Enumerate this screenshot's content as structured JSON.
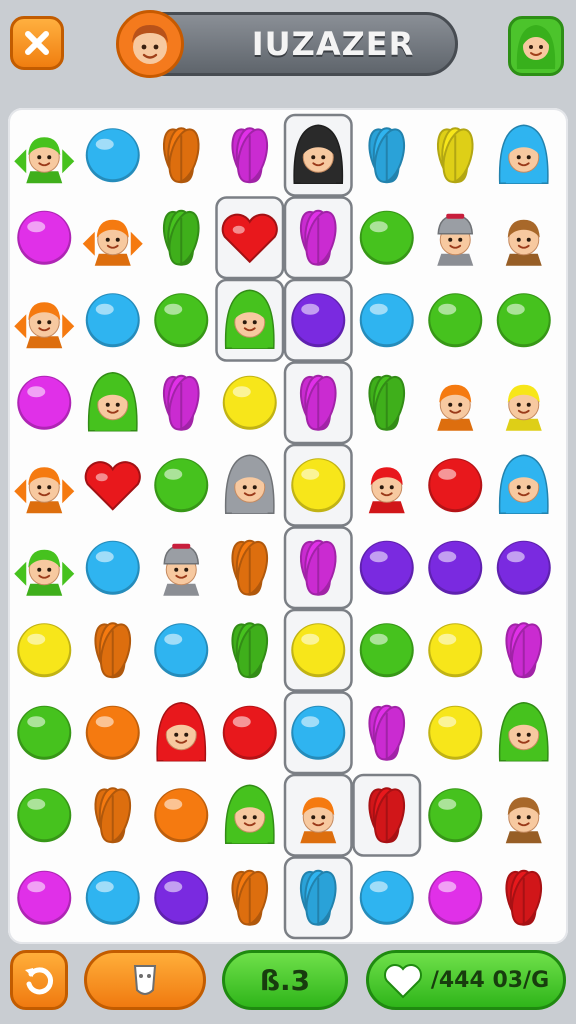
{
  "header": {
    "close_icon": "close-x-icon",
    "title": "IUZAZER",
    "title_avatar_icon": "player-avatar-icon",
    "profile_avatar_icon": "green-hood-avatar-icon"
  },
  "board": {
    "rows": 10,
    "cols": 8,
    "tiles": [
      [
        "green-bird-avatar",
        "blue-gem",
        "orange-leaf",
        "magenta-leaf",
        "black-hood-avatar",
        "blue-leaf",
        "yellow-leaf",
        "blue-hood-avatar"
      ],
      [
        "magenta-gem",
        "orange-bird-avatar",
        "green-leaf",
        "red-heart",
        "magenta-leaf",
        "green-gem",
        "grey-cap-avatar",
        "brown-hair-avatar"
      ],
      [
        "orange-bird-avatar",
        "blue-gem",
        "green-gem",
        "green-hood-avatar",
        "purple-gem",
        "blue-gem",
        "green-gem",
        "green-gem"
      ],
      [
        "magenta-gem",
        "green-hood-avatar",
        "magenta-leaf",
        "yellow-gem",
        "magenta-leaf",
        "green-leaf",
        "orange-hair-avatar",
        "yellow-hair-avatar"
      ],
      [
        "orange-bird-avatar",
        "red-heart",
        "green-gem",
        "grey-hood-avatar",
        "yellow-gem",
        "red-hair-avatar",
        "red-gem",
        "blue-hood-avatar"
      ],
      [
        "green-bird-avatar",
        "blue-gem",
        "grey-cap-avatar",
        "orange-leaf",
        "magenta-leaf",
        "purple-gem",
        "purple-gem",
        "purple-gem"
      ],
      [
        "yellow-gem",
        "orange-leaf",
        "blue-gem",
        "green-leaf",
        "yellow-gem",
        "green-gem",
        "yellow-gem",
        "magenta-leaf"
      ],
      [
        "green-gem",
        "orange-gem",
        "red-hood-avatar",
        "red-gem",
        "blue-gem",
        "magenta-leaf",
        "yellow-gem",
        "green-hood-avatar"
      ],
      [
        "green-gem",
        "orange-leaf",
        "orange-gem",
        "green-hood-avatar",
        "orange-hair-avatar",
        "red-leaf",
        "green-gem",
        "brown-hair-avatar"
      ],
      [
        "magenta-gem",
        "blue-gem",
        "purple-gem",
        "orange-leaf",
        "blue-leaf",
        "blue-gem",
        "magenta-gem",
        "red-leaf"
      ]
    ],
    "highlighted_path": [
      [
        0,
        4
      ],
      [
        1,
        3
      ],
      [
        1,
        4
      ],
      [
        2,
        3
      ],
      [
        2,
        4
      ],
      [
        3,
        4
      ],
      [
        4,
        4
      ],
      [
        5,
        4
      ],
      [
        6,
        4
      ],
      [
        7,
        4
      ],
      [
        8,
        4
      ],
      [
        8,
        5
      ],
      [
        9,
        4
      ]
    ],
    "colors": {
      "red": "#e8181c",
      "orange": "#f57a10",
      "yellow": "#f7e61a",
      "green": "#46c21e",
      "blue": "#2fb4f0",
      "purple": "#7a2ae0",
      "magenta": "#e030e8",
      "grey": "#9a9ea4",
      "black": "#2a2a2a",
      "brown": "#a8682a"
    }
  },
  "footer": {
    "undo_icon": "undo-arrow-icon",
    "booster_icon": "shovel-booster-icon",
    "score": "ß.3",
    "lives_icon": "heart-icon",
    "lives_text": "/444 03/G"
  }
}
